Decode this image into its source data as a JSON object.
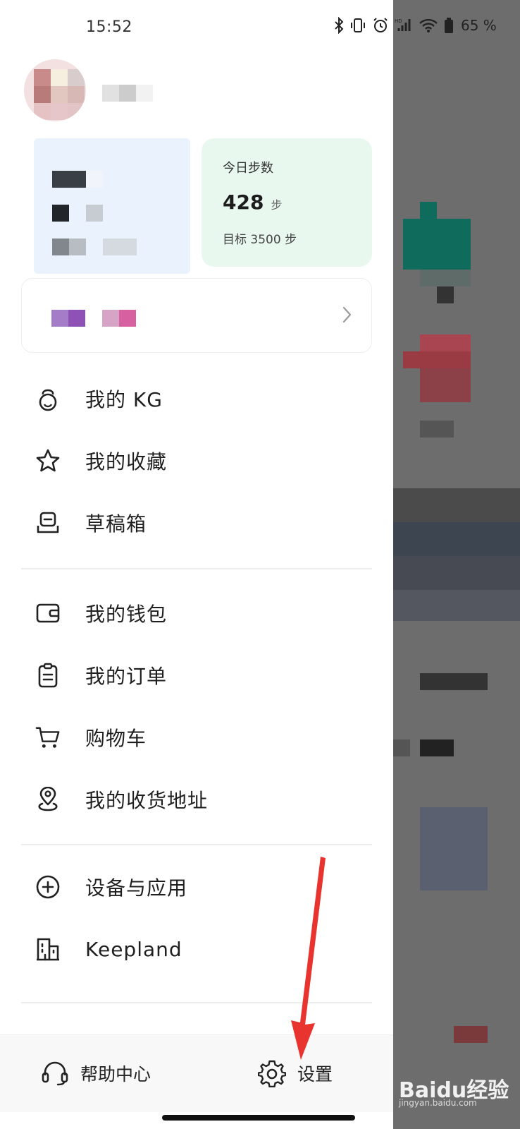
{
  "status_bar": {
    "time": "15:52",
    "battery": "65 %",
    "icons": [
      "bluetooth-icon",
      "vibrate-icon",
      "alarm-icon",
      "signal-hd-icon",
      "wifi-icon",
      "battery-icon"
    ]
  },
  "steps_card": {
    "title": "今日步数",
    "value": "428",
    "unit": "步",
    "goal": "目标 3500 步"
  },
  "menu": {
    "section1": [
      {
        "label": "我的 KG",
        "icon": "kettlebell-icon"
      },
      {
        "label": "我的收藏",
        "icon": "star-icon"
      },
      {
        "label": "草稿箱",
        "icon": "drafts-icon"
      }
    ],
    "section2": [
      {
        "label": "我的钱包",
        "icon": "wallet-icon"
      },
      {
        "label": "我的订单",
        "icon": "order-clipboard-icon"
      },
      {
        "label": "购物车",
        "icon": "cart-icon"
      },
      {
        "label": "我的收货地址",
        "icon": "location-pin-icon"
      }
    ],
    "section3": [
      {
        "label": "设备与应用",
        "icon": "plus-circle-icon"
      },
      {
        "label": "Keepland",
        "icon": "building-icon"
      }
    ]
  },
  "bottom": {
    "help_label": "帮助中心",
    "settings_label": "设置"
  },
  "watermark": {
    "brand": "Baidu经验",
    "url": "jingyan.baidu.com"
  },
  "colors": {
    "steps_card_bg": "#e9f8ef",
    "profile_card_bg": "#eaf3fd",
    "arrow_red": "#e8332f",
    "overlay": "#6d6d6d"
  }
}
